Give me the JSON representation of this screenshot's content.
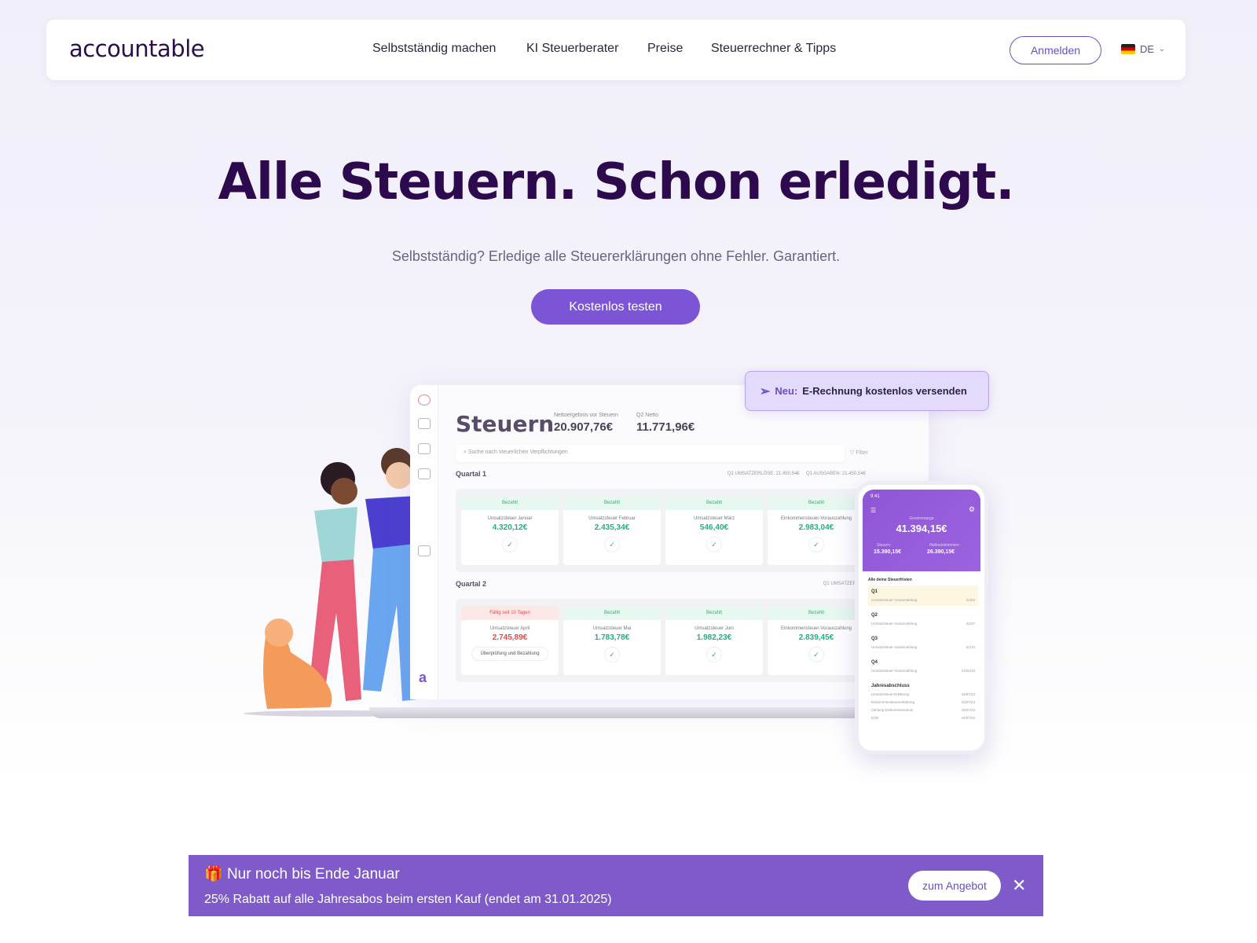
{
  "header": {
    "logo": "accountable",
    "nav": [
      "Selbstständig machen",
      "KI Steuerberater",
      "Preise",
      "Steuerrechner & Tipps"
    ],
    "login": "Anmelden",
    "lang": "DE"
  },
  "hero": {
    "title": "Alle Steuern. Schon erledigt.",
    "subtitle": "Selbstständig? Erledige alle Steuererklärungen ohne Fehler. Garantiert.",
    "cta": "Kostenlos testen"
  },
  "badge": {
    "prefix": "Neu:",
    "text": "E-Rechnung kostenlos versenden"
  },
  "dashboard": {
    "title": "Steuern",
    "kpis": [
      {
        "label": "Nettoergebnis vor Steuern",
        "value": "20.907,76€"
      },
      {
        "label": "Q2 Netto",
        "value": "11.771,96€"
      }
    ],
    "search_placeholder": "Suche nach steuerlichen Verpflichtungen",
    "filter": "Filter",
    "quarters": [
      {
        "label": "Quartal 1",
        "stats": [
          "Q1 UMSATZERLÖSE: 21.450,54€",
          "Q1 AUSGABEN: 21.450,54€"
        ],
        "cards": [
          {
            "status": "Bezahlt",
            "name": "Umsatzsteuer Januar",
            "amount": "4.320,12€"
          },
          {
            "status": "Bezahlt",
            "name": "Umsatzsteuer Februar",
            "amount": "2.435,34€"
          },
          {
            "status": "Bezahlt",
            "name": "Umsatzsteuer März",
            "amount": "546,40€"
          },
          {
            "status": "Bezahlt",
            "name": "Einkommensteuer-Vorauszahlung",
            "amount": "2.983,04€"
          }
        ]
      },
      {
        "label": "Quartal 2",
        "stats": [
          "Q1 UMSATZERLÖS"
        ],
        "cards": [
          {
            "status": "Fällig seit 10 Tagen",
            "name": "Umsatzsteuer April",
            "amount": "2.745,89€",
            "due": true,
            "action": "Überprüfung und Bezahlung"
          },
          {
            "status": "Bezahlt",
            "name": "Umsatzsteuer Mai",
            "amount": "1.783,78€"
          },
          {
            "status": "Bezahlt",
            "name": "Umsatzsteuer Juni",
            "amount": "1.982,23€"
          },
          {
            "status": "Bezahlt",
            "name": "Einkommensteuer-Vorauszahlung",
            "amount": "2.839,45€"
          }
        ]
      }
    ]
  },
  "phone": {
    "time": "9:41",
    "profit_label": "Gewinnmarge",
    "profit": "41.394,15€",
    "taxes_label": "Steuern",
    "taxes": "15.390,15€",
    "net_label": "Nettoeinkommen",
    "net": "26.390,15€",
    "list_title": "Alle deine Steuerfristen",
    "groups": [
      {
        "q": "Q1",
        "rows": [
          [
            "Umsatzsteuer-Voranmeldung",
            "21/04"
          ]
        ]
      },
      {
        "q": "Q2",
        "rows": [
          [
            "Umsatzsteuer-Voranmeldung",
            "21/07"
          ]
        ]
      },
      {
        "q": "Q3",
        "rows": [
          [
            "Umsatzsteuer-Voranmeldung",
            "21/10"
          ]
        ]
      },
      {
        "q": "Q4",
        "rows": [
          [
            "Umsatzsteuer-Voranmeldung",
            "21/01/23"
          ]
        ]
      },
      {
        "q": "Jahresabschluss",
        "rows": [
          [
            "Umsatzsteuer-Erklärung",
            "15/07/23"
          ],
          [
            "Einkommensteuererklärung",
            "15/07/23"
          ],
          [
            "Zahlung Einkommensteuer",
            "15/07/23"
          ],
          [
            "EÜR",
            "15/07/23"
          ]
        ]
      }
    ]
  },
  "banner": {
    "icon": "gift-icon",
    "title": "Nur noch bis Ende Januar",
    "text": "25% Rabatt auf alle Jahresabos beim ersten Kauf (endet am 31.01.2025)",
    "offer": "zum Angebot",
    "close": "✕"
  },
  "colors": {
    "brand": "#7b55d6",
    "dark": "#2d0a4e",
    "banner": "#7f5bc9",
    "paid": "#22b07a",
    "due": "#e14b4b"
  }
}
